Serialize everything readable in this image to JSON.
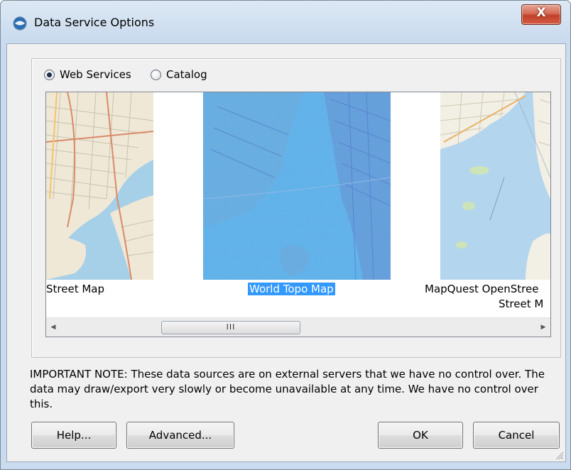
{
  "window": {
    "title": "Data Service Options",
    "close_label": "X"
  },
  "source_options": [
    {
      "label": "Web Services",
      "selected": true
    },
    {
      "label": "Catalog",
      "selected": false
    }
  ],
  "gallery": {
    "items": [
      {
        "caption_lines": [
          "Street Map"
        ],
        "selected": false,
        "map_icon": "street-map-thumbnail"
      },
      {
        "caption_lines": [
          "World Topo Map"
        ],
        "selected": true,
        "map_icon": "world-topo-map-thumbnail"
      },
      {
        "caption_lines": [
          "MapQuest OpenStree",
          "Street M"
        ],
        "selected": false,
        "map_icon": "mapquest-openstreetmap-thumbnail"
      }
    ],
    "scrollbar_grip": "III",
    "selection_color": "#3399ff"
  },
  "note": "IMPORTANT NOTE: These data sources are on external servers that we have no control over. The data may draw/export very slowly or become unavailable at any time. We have no control over this.",
  "buttons": {
    "help": "Help...",
    "advanced": "Advanced...",
    "ok": "OK",
    "cancel": "Cancel"
  }
}
